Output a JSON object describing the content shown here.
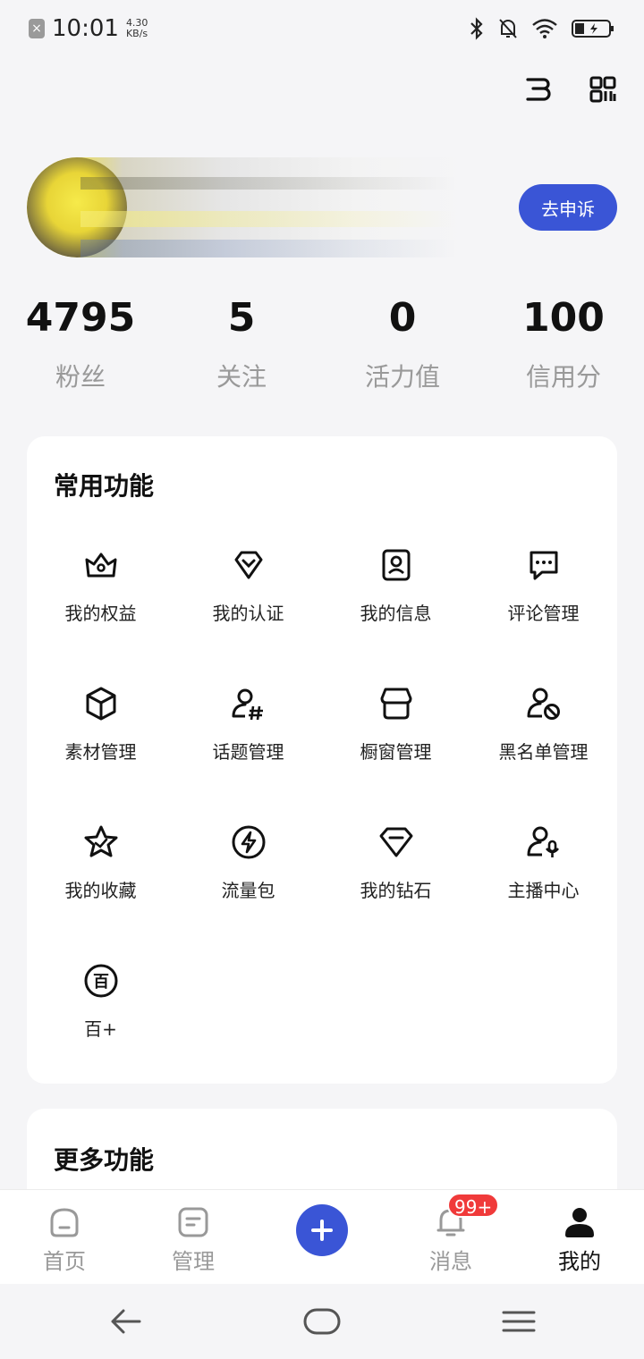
{
  "status_bar": {
    "time": "10:01",
    "speed_value": "4.30",
    "speed_unit": "KB/s"
  },
  "profile": {
    "appeal_button": "去申诉"
  },
  "stats": [
    {
      "value": "4795",
      "label": "粉丝"
    },
    {
      "value": "5",
      "label": "关注"
    },
    {
      "value": "0",
      "label": "活力值"
    },
    {
      "value": "100",
      "label": "信用分"
    }
  ],
  "common_functions": {
    "title": "常用功能",
    "items": [
      {
        "label": "我的权益",
        "icon": "crown-icon"
      },
      {
        "label": "我的认证",
        "icon": "verified-badge-icon"
      },
      {
        "label": "我的信息",
        "icon": "profile-card-icon"
      },
      {
        "label": "评论管理",
        "icon": "comment-icon"
      },
      {
        "label": "素材管理",
        "icon": "cube-icon"
      },
      {
        "label": "话题管理",
        "icon": "user-hashtag-icon"
      },
      {
        "label": "橱窗管理",
        "icon": "store-icon"
      },
      {
        "label": "黑名单管理",
        "icon": "user-block-icon"
      },
      {
        "label": "我的收藏",
        "icon": "star-icon"
      },
      {
        "label": "流量包",
        "icon": "lightning-icon"
      },
      {
        "label": "我的钻石",
        "icon": "diamond-icon"
      },
      {
        "label": "主播中心",
        "icon": "user-mic-icon"
      },
      {
        "label": "百+",
        "icon": "bai-plus-icon"
      }
    ]
  },
  "more_functions": {
    "title": "更多功能"
  },
  "bottom_nav": {
    "items": [
      {
        "label": "首页",
        "icon": "home-icon"
      },
      {
        "label": "管理",
        "icon": "manage-icon"
      },
      {
        "label": "",
        "icon": "plus-icon"
      },
      {
        "label": "消息",
        "icon": "bell-icon"
      },
      {
        "label": "我的",
        "icon": "person-icon"
      }
    ],
    "active": "我的",
    "message_badge": "99+"
  },
  "colors": {
    "accent": "#3a55d6",
    "badge": "#f03a3a",
    "background": "#f5f5f7"
  }
}
